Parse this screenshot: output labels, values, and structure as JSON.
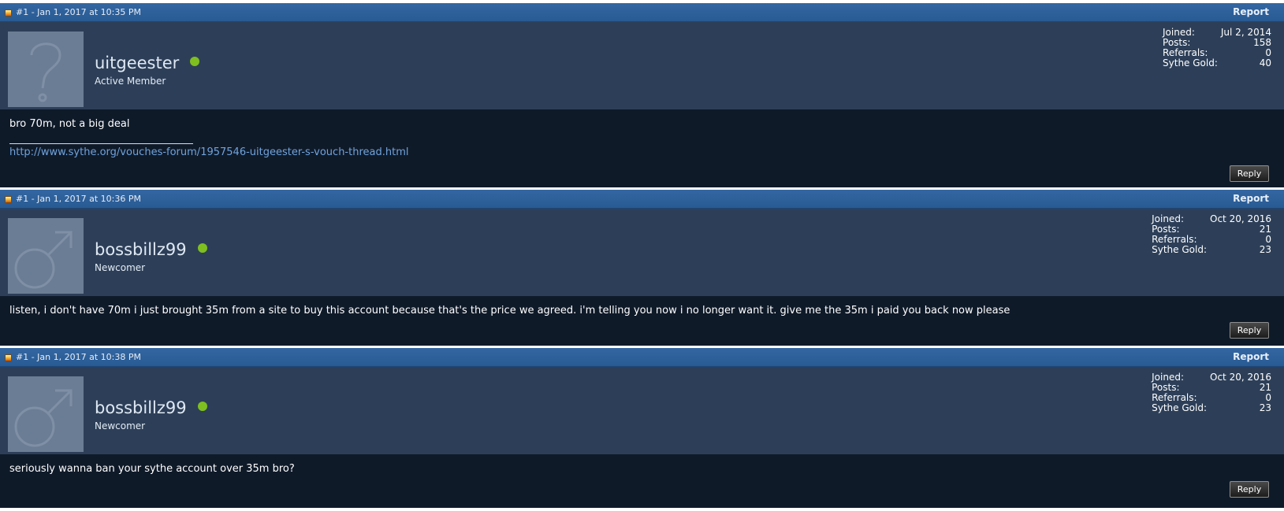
{
  "posts": [
    {
      "date": "#1 - Jan 1, 2017 at 10:35 PM",
      "report_label": "Report",
      "avatar_icon": "question-mark-icon",
      "username": "uitgeester",
      "user_title": "Active Member",
      "stats": {
        "joined_label": "Joined:",
        "joined": "Jul 2, 2014",
        "posts_label": "Posts:",
        "posts": "158",
        "referrals_label": "Referrals:",
        "referrals": "0",
        "gold_label": "Sythe Gold:",
        "gold": "40"
      },
      "message": "bro 70m, not a big deal",
      "signature_link": "http://www.sythe.org/vouches-forum/1957546-uitgeester-s-vouch-thread.html",
      "reply_label": "Reply"
    },
    {
      "date": "#1 - Jan 1, 2017 at 10:36 PM",
      "report_label": "Report",
      "avatar_icon": "male-symbol-icon",
      "username": "bossbillz99",
      "user_title": "Newcomer",
      "stats": {
        "joined_label": "Joined:",
        "joined": "Oct 20, 2016",
        "posts_label": "Posts:",
        "posts": "21",
        "referrals_label": "Referrals:",
        "referrals": "0",
        "gold_label": "Sythe Gold:",
        "gold": "23"
      },
      "message": "listen, i don't have 70m i just brought 35m from a site to buy this account because that's the price we agreed. i'm telling you now i no longer want it. give me the 35m i paid you back now please",
      "reply_label": "Reply"
    },
    {
      "date": "#1 - Jan 1, 2017 at 10:38 PM",
      "report_label": "Report",
      "avatar_icon": "male-symbol-icon",
      "username": "bossbillz99",
      "user_title": "Newcomer",
      "stats": {
        "joined_label": "Joined:",
        "joined": "Oct 20, 2016",
        "posts_label": "Posts:",
        "posts": "21",
        "referrals_label": "Referrals:",
        "referrals": "0",
        "gold_label": "Sythe Gold:",
        "gold": "23"
      },
      "message": "seriously wanna ban your sythe account over 35m bro?",
      "reply_label": "Reply"
    }
  ],
  "colors": {
    "header_blue": "#2c5f99",
    "userinfo_bg": "#2d3f58",
    "message_bg": "#0f1a29",
    "online_green": "#7fbf1f",
    "link_blue": "#6fa3dc"
  }
}
